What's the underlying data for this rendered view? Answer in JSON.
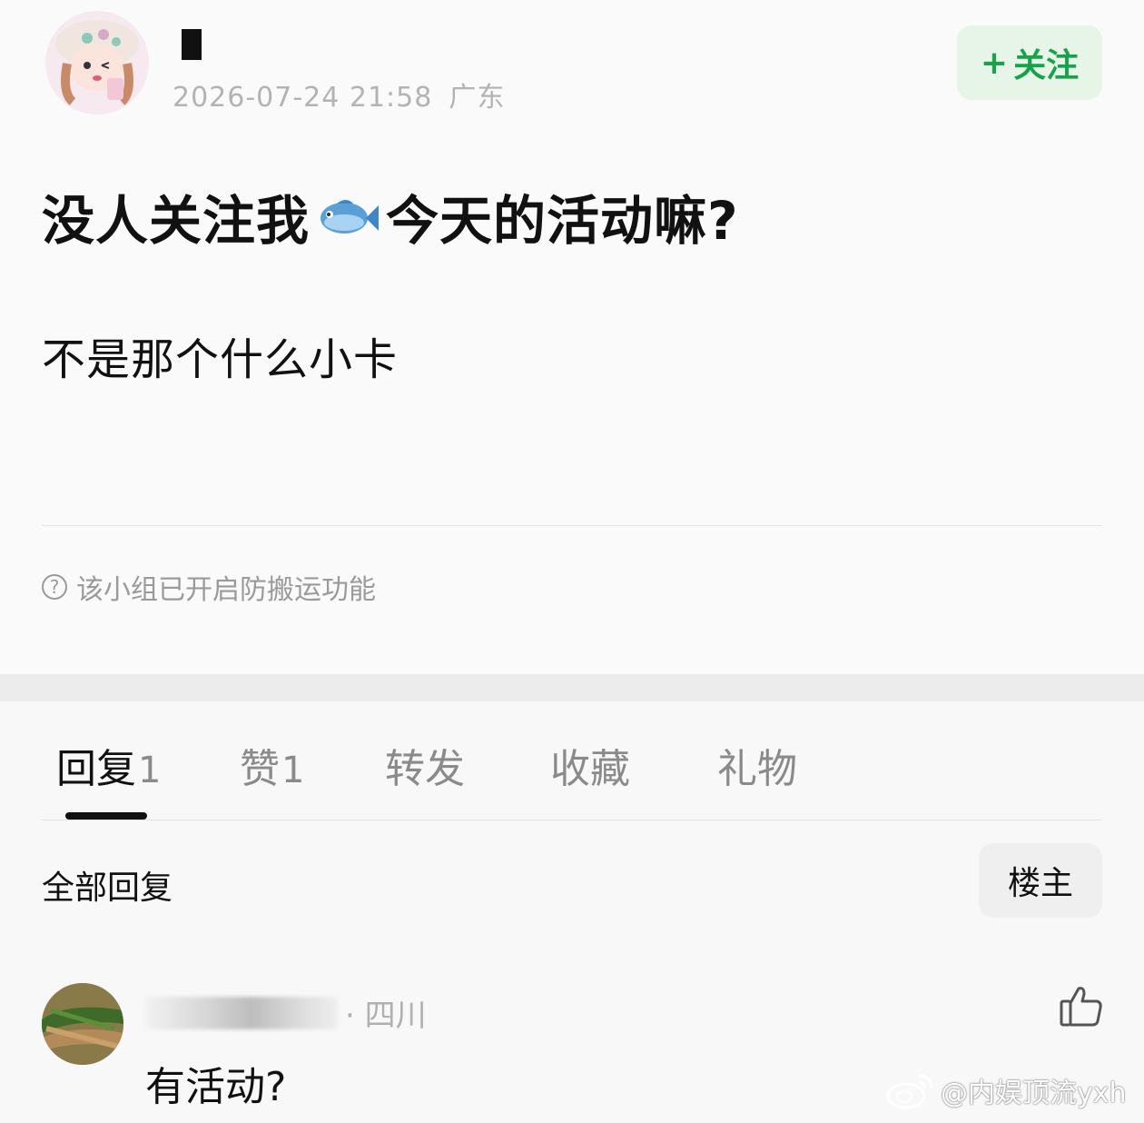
{
  "post": {
    "author_name": "",
    "date": "2026-07-24 21:58",
    "location": "广东",
    "follow_label": "关注",
    "follow_plus": "+",
    "title_before": "没人关注我",
    "title_after": "今天的活动嘛?",
    "body": "不是那个什么小卡",
    "notice": "该小组已开启防搬运功能"
  },
  "tabs": [
    {
      "label": "回复",
      "count": "1",
      "active": true
    },
    {
      "label": "赞",
      "count": "1",
      "active": false
    },
    {
      "label": "转发",
      "count": "",
      "active": false
    },
    {
      "label": "收藏",
      "count": "",
      "active": false
    },
    {
      "label": "礼物",
      "count": "",
      "active": false
    }
  ],
  "replies_header": {
    "title": "全部回复",
    "filter_label": "楼主"
  },
  "replies": [
    {
      "location": "· 四川",
      "text": "有活动?"
    }
  ],
  "watermark": "@内娱顶流yxh",
  "colors": {
    "accent_green": "#16a34a",
    "follow_bg": "#e6f5e8"
  }
}
